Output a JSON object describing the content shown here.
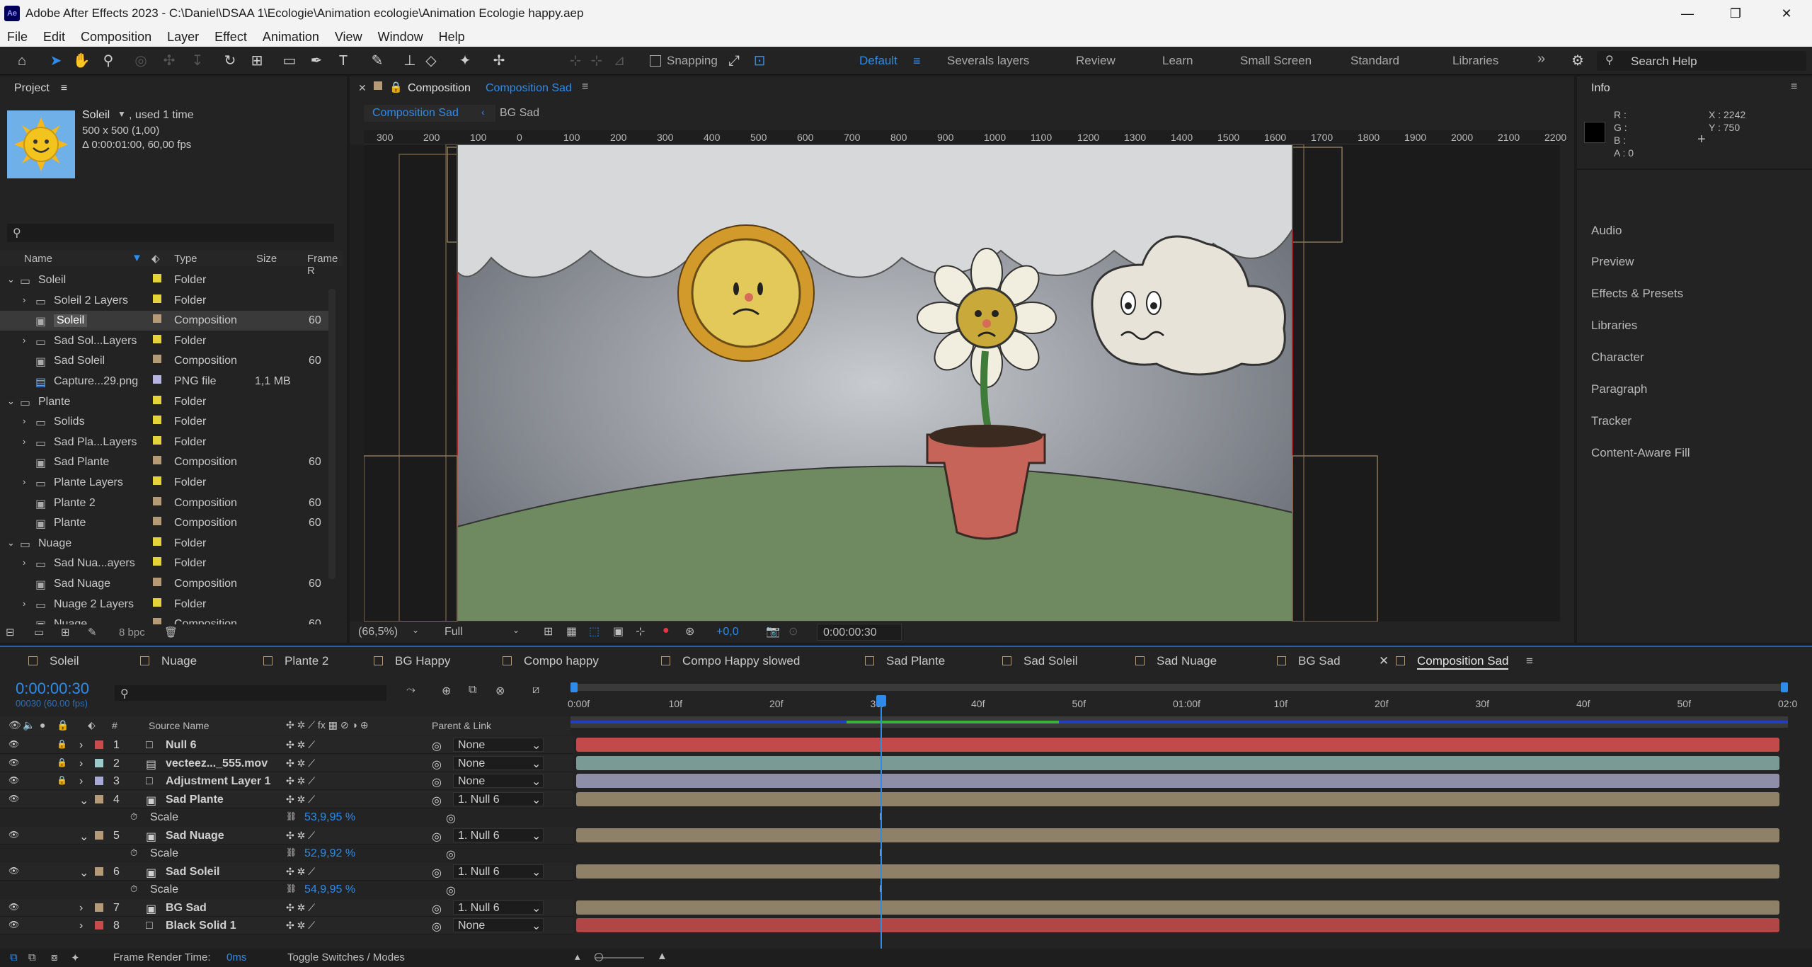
{
  "app": {
    "title": "Adobe After Effects 2023 - C:\\Daniel\\DSAA 1\\Ecologie\\Animation ecologie\\Animation Ecologie happy.aep",
    "logo": "Ae"
  },
  "menu": [
    "File",
    "Edit",
    "Composition",
    "Layer",
    "Effect",
    "Animation",
    "View",
    "Window",
    "Help"
  ],
  "toolbar": {
    "snapping": "Snapping",
    "workspaces": [
      "Default",
      "Severals layers",
      "Review",
      "Learn",
      "Small Screen",
      "Standard",
      "Libraries"
    ],
    "search_placeholder": "Search Help",
    "more": "»"
  },
  "project": {
    "title": "Project",
    "item_name": "Soleil",
    "used": ", used 1 time",
    "dims": "500 x 500 (1,00)",
    "duration": "Δ 0:00:01:00, 60,00 fps",
    "cols": [
      "Name",
      "Type",
      "Size",
      "Frame R"
    ],
    "bpc": "8 bpc",
    "items": [
      {
        "name": "Soleil",
        "type": "Folder",
        "size": "",
        "fr": "",
        "color": "#e5d33a",
        "indent": 0,
        "exp": "v",
        "icon": "folder"
      },
      {
        "name": "Soleil 2 Layers",
        "type": "Folder",
        "size": "",
        "fr": "",
        "color": "#e5d33a",
        "indent": 1,
        "exp": ">",
        "icon": "folder"
      },
      {
        "name": "Soleil",
        "type": "Composition",
        "size": "",
        "fr": "60",
        "color": "#b59a77",
        "indent": 1,
        "exp": "",
        "icon": "comp",
        "sel": true
      },
      {
        "name": "Sad Sol...Layers",
        "type": "Folder",
        "size": "",
        "fr": "",
        "color": "#e5d33a",
        "indent": 1,
        "exp": ">",
        "icon": "folder"
      },
      {
        "name": "Sad Soleil",
        "type": "Composition",
        "size": "",
        "fr": "60",
        "color": "#b59a77",
        "indent": 1,
        "exp": "",
        "icon": "comp"
      },
      {
        "name": "Capture...29.png",
        "type": "PNG file",
        "size": "1,1 MB",
        "fr": "",
        "color": "#b7b4e0",
        "indent": 1,
        "exp": "",
        "icon": "file"
      },
      {
        "name": "Plante",
        "type": "Folder",
        "size": "",
        "fr": "",
        "color": "#e5d33a",
        "indent": 0,
        "exp": "v",
        "icon": "folder"
      },
      {
        "name": "Solids",
        "type": "Folder",
        "size": "",
        "fr": "",
        "color": "#e5d33a",
        "indent": 1,
        "exp": ">",
        "icon": "folder"
      },
      {
        "name": "Sad Pla...Layers",
        "type": "Folder",
        "size": "",
        "fr": "",
        "color": "#e5d33a",
        "indent": 1,
        "exp": ">",
        "icon": "folder"
      },
      {
        "name": "Sad Plante",
        "type": "Composition",
        "size": "",
        "fr": "60",
        "color": "#b59a77",
        "indent": 1,
        "exp": "",
        "icon": "comp"
      },
      {
        "name": "Plante Layers",
        "type": "Folder",
        "size": "",
        "fr": "",
        "color": "#e5d33a",
        "indent": 1,
        "exp": ">",
        "icon": "folder"
      },
      {
        "name": "Plante 2",
        "type": "Composition",
        "size": "",
        "fr": "60",
        "color": "#b59a77",
        "indent": 1,
        "exp": "",
        "icon": "comp"
      },
      {
        "name": "Plante",
        "type": "Composition",
        "size": "",
        "fr": "60",
        "color": "#b59a77",
        "indent": 1,
        "exp": "",
        "icon": "comp"
      },
      {
        "name": "Nuage",
        "type": "Folder",
        "size": "",
        "fr": "",
        "color": "#e5d33a",
        "indent": 0,
        "exp": "v",
        "icon": "folder"
      },
      {
        "name": "Sad Nua...ayers",
        "type": "Folder",
        "size": "",
        "fr": "",
        "color": "#e5d33a",
        "indent": 1,
        "exp": ">",
        "icon": "folder"
      },
      {
        "name": "Sad Nuage",
        "type": "Composition",
        "size": "",
        "fr": "60",
        "color": "#b59a77",
        "indent": 1,
        "exp": "",
        "icon": "comp"
      },
      {
        "name": "Nuage 2 Layers",
        "type": "Folder",
        "size": "",
        "fr": "",
        "color": "#e5d33a",
        "indent": 1,
        "exp": ">",
        "icon": "folder"
      },
      {
        "name": "Nuage",
        "type": "Composition",
        "size": "",
        "fr": "60",
        "color": "#b59a77",
        "indent": 1,
        "exp": "",
        "icon": "comp"
      }
    ]
  },
  "composition": {
    "panel_label": "Composition",
    "name": "Composition Sad",
    "nav": [
      "Composition Sad",
      "BG Sad"
    ],
    "zoom": "(66,5%)",
    "resolution": "Full",
    "exposure": "+0,0",
    "timecode": "0:00:00:30",
    "ruler": [
      "300",
      "200",
      "100",
      "0",
      "100",
      "200",
      "300",
      "400",
      "500",
      "600",
      "700",
      "800",
      "900",
      "1000",
      "1100",
      "1200",
      "1300",
      "1400",
      "1500",
      "1600",
      "1700",
      "1800",
      "1900",
      "2000",
      "2100",
      "2200"
    ]
  },
  "info": {
    "title": "Info",
    "r": "R :",
    "g": "G :",
    "b": "B :",
    "a": "A :  0",
    "x": "X : 2242",
    "y": "Y : 750",
    "sections": [
      "Audio",
      "Preview",
      "Effects & Presets",
      "Libraries",
      "Character",
      "Paragraph",
      "Tracker",
      "Content-Aware Fill"
    ]
  },
  "timeline": {
    "tabs": [
      {
        "name": "Soleil",
        "color": "#b59a77"
      },
      {
        "name": "Nuage",
        "color": "#b59a77"
      },
      {
        "name": "Plante 2",
        "color": "#b59a77"
      },
      {
        "name": "BG Happy",
        "color": "#b59a77"
      },
      {
        "name": "Compo happy",
        "color": "#b59a77"
      },
      {
        "name": "Compo Happy slowed",
        "color": "#b59a77"
      },
      {
        "name": "Sad Plante",
        "color": "#b59a77"
      },
      {
        "name": "Sad Soleil",
        "color": "#b59a77"
      },
      {
        "name": "Sad Nuage",
        "color": "#b59a77"
      },
      {
        "name": "BG Sad",
        "color": "#b59a77"
      },
      {
        "name": "Composition Sad",
        "color": "#b59a77",
        "active": true
      }
    ],
    "timecode": "0:00:00:30",
    "frames": "00030 (60.00 fps)",
    "col_num": "#",
    "col_source": "Source Name",
    "col_parent": "Parent & Link",
    "ticks": [
      "0:00f",
      "10f",
      "20f",
      "30f",
      "40f",
      "50f",
      "01:00f",
      "10f",
      "20f",
      "30f",
      "40f",
      "50f",
      "02:0"
    ],
    "playhead": 0.25,
    "layers": [
      {
        "num": "1",
        "name": "Null 6",
        "color": "#c94b4b",
        "parent": "None",
        "type": "null",
        "bar": "#c24a4a"
      },
      {
        "num": "2",
        "name": "vecteez..._555.mov",
        "color": "#9cc9c9",
        "parent": "None",
        "type": "mov",
        "bar": "#7a9a95"
      },
      {
        "num": "3",
        "name": "Adjustment Layer 1",
        "color": "#a9a9d6",
        "parent": "None",
        "type": "adj",
        "bar": "#8e8ea8"
      },
      {
        "num": "4",
        "name": "Sad Plante",
        "color": "#b59a77",
        "parent": "1. Null 6",
        "type": "comp",
        "bar": "#8e8168",
        "exp": "v",
        "prop": {
          "name": "Scale",
          "value": "53,9,95 %"
        }
      },
      {
        "num": "5",
        "name": "Sad Nuage",
        "color": "#b59a77",
        "parent": "1. Null 6",
        "type": "comp",
        "bar": "#8e8168",
        "exp": "v",
        "prop": {
          "name": "Scale",
          "value": "52,9,92 %"
        }
      },
      {
        "num": "6",
        "name": "Sad Soleil",
        "color": "#b59a77",
        "parent": "1. Null 6",
        "type": "comp",
        "bar": "#8e8168",
        "exp": "v",
        "prop": {
          "name": "Scale",
          "value": "54,9,95 %"
        }
      },
      {
        "num": "7",
        "name": "BG Sad",
        "color": "#b59a77",
        "parent": "1. Null 6",
        "type": "comp",
        "bar": "#8e8168"
      },
      {
        "num": "8",
        "name": "Black Solid 1",
        "color": "#c94b4b",
        "parent": "None",
        "type": "solid",
        "bar": "#b04646"
      }
    ],
    "render_time_label": "Frame Render Time:",
    "render_time": "0ms",
    "toggle": "Toggle Switches / Modes"
  }
}
